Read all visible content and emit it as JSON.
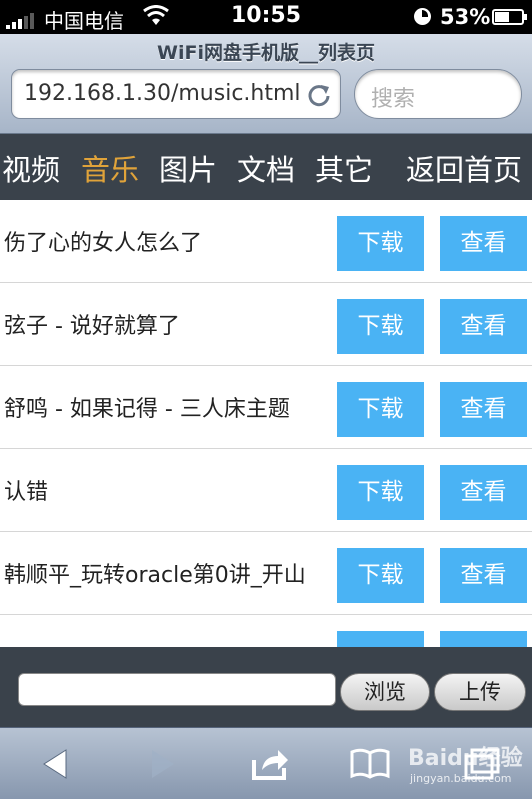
{
  "status_bar": {
    "carrier": "中国电信",
    "time": "10:55",
    "battery_percent": "53%",
    "battery_level": 0.53,
    "signal_bars": 3
  },
  "browser": {
    "page_title": "WiFi网盘手机版__列表页",
    "url": "192.168.1.30/music.html",
    "search_placeholder": "搜索"
  },
  "categories": [
    {
      "label": "视频",
      "active": false
    },
    {
      "label": "音乐",
      "active": true
    },
    {
      "label": "图片",
      "active": false
    },
    {
      "label": "文档",
      "active": false
    },
    {
      "label": "其它",
      "active": false
    },
    {
      "label": "返回首页",
      "active": false
    }
  ],
  "files": [
    {
      "name": "伤了心的女人怎么了",
      "download": "下载",
      "view": "查看"
    },
    {
      "name": "弦子 - 说好就算了",
      "download": "下载",
      "view": "查看"
    },
    {
      "name": "舒鸣 - 如果记得 - 三人床主题",
      "download": "下载",
      "view": "查看"
    },
    {
      "name": "认错",
      "download": "下载",
      "view": "查看"
    },
    {
      "name": "韩顺平_玩转oracle第0讲_开山",
      "download": "下载",
      "view": "查看"
    },
    {
      "name": "",
      "download": "",
      "view": ""
    }
  ],
  "upload": {
    "file_value": "",
    "browse_label": "浏览",
    "submit_label": "上传"
  },
  "toolbar": {
    "icons": [
      "back-icon",
      "forward-icon",
      "share-icon",
      "bookmarks-icon",
      "pages-icon"
    ]
  },
  "watermark": {
    "text": "Baidu经验",
    "url": "jingyan.baidu.com"
  },
  "colors": {
    "accent_button": "#4ab3f4",
    "active_category": "#e0a33a",
    "nav_background": "#3a424b"
  }
}
